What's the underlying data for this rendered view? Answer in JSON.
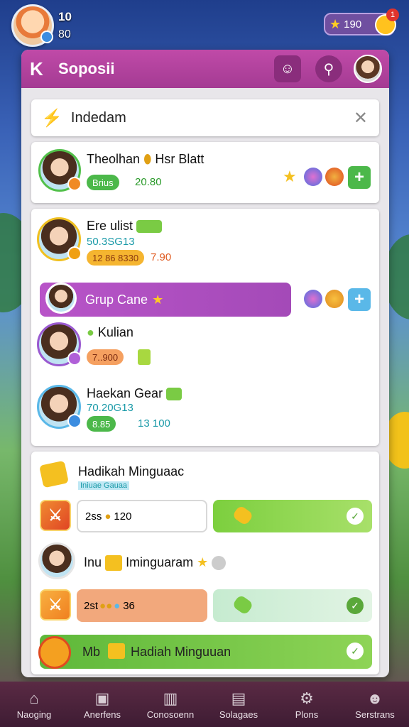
{
  "hud": {
    "player_name": "10",
    "player_sub": "80",
    "coins": "190",
    "notification": "1"
  },
  "panel": {
    "back_label": "K",
    "title": "Soposii"
  },
  "search": {
    "text": "Indedam"
  },
  "friends": [
    {
      "name": "Theolhan",
      "name_extra": "Hsr Blatt",
      "pill": "Brius",
      "value": "20.80"
    },
    {
      "name": "Ere ulist",
      "sub_value": "50.3SG13",
      "pill": "12 86 8330",
      "value": "7.90"
    },
    {
      "name": "Kulian",
      "pill": "7..900"
    },
    {
      "name": "Haekan Gear",
      "sub_value": "70.20G13",
      "pill": "8.85",
      "value": "13 100"
    }
  ],
  "group": {
    "label": "Grup Cane"
  },
  "rewards": {
    "title": "Hadikah Minguaac",
    "subtitle": "Iniuae Gauaa",
    "row1_field": "2ss",
    "row1_value": "120",
    "row2_name": "Inu",
    "row2_title": "Iminguaram",
    "row3_field": "2st",
    "row3_value": "36",
    "claim_prefix": "Mb",
    "claim_label": "Hadiah Minguuan"
  },
  "nav": [
    {
      "label": "Naoging",
      "icon": "home-icon"
    },
    {
      "label": "Anerfens",
      "icon": "bag-icon"
    },
    {
      "label": "Conosoenn",
      "icon": "shop-icon"
    },
    {
      "label": "Solagaes",
      "icon": "chart-icon"
    },
    {
      "label": "Plons",
      "icon": "gear-icon"
    },
    {
      "label": "Serstrans",
      "icon": "friends-icon"
    }
  ]
}
